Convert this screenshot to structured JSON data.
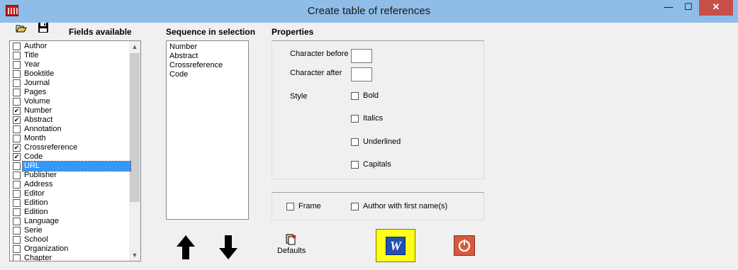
{
  "window": {
    "title": "Create table of references",
    "minimize": "—",
    "maximize": "☐",
    "close": "✕"
  },
  "toolbar": {
    "open_icon": "folder-open-icon",
    "save_icon": "floppy-save-icon"
  },
  "fields": {
    "heading": "Fields available",
    "items": [
      {
        "label": "Author",
        "checked": false
      },
      {
        "label": "Title",
        "checked": false
      },
      {
        "label": "Year",
        "checked": false
      },
      {
        "label": "Booktitle",
        "checked": false
      },
      {
        "label": "Journal",
        "checked": false
      },
      {
        "label": "Pages",
        "checked": false
      },
      {
        "label": "Volume",
        "checked": false
      },
      {
        "label": "Number",
        "checked": true
      },
      {
        "label": "Abstract",
        "checked": true
      },
      {
        "label": "Annotation",
        "checked": false
      },
      {
        "label": "Month",
        "checked": false
      },
      {
        "label": "Crossreference",
        "checked": true
      },
      {
        "label": "Code",
        "checked": true
      },
      {
        "label": "URL",
        "checked": false,
        "selected": true
      },
      {
        "label": "Publisher",
        "checked": false
      },
      {
        "label": "Address",
        "checked": false
      },
      {
        "label": "Editor",
        "checked": false
      },
      {
        "label": "Edition",
        "checked": false
      },
      {
        "label": "Edition",
        "checked": false
      },
      {
        "label": "Language",
        "checked": false
      },
      {
        "label": "Serie",
        "checked": false
      },
      {
        "label": "School",
        "checked": false
      },
      {
        "label": "Organization",
        "checked": false
      },
      {
        "label": "Chapter",
        "checked": false
      }
    ]
  },
  "sequence": {
    "heading": "Sequence in selection",
    "items": [
      "Number",
      "Abstract",
      "Crossreference",
      "Code"
    ]
  },
  "properties": {
    "heading": "Properties",
    "char_before_label": "Character before",
    "char_before_value": "",
    "char_after_label": "Character after",
    "char_after_value": "",
    "style_label": "Style",
    "bold_label": "Bold",
    "italics_label": "Italics",
    "underlined_label": "Underlined",
    "capitals_label": "Capitals",
    "frame_label": "Frame",
    "author_first_name_label": "Author with first name(s)"
  },
  "actions": {
    "up_icon": "arrow-up-icon",
    "down_icon": "arrow-down-icon",
    "defaults_label": "Defaults",
    "word_glyph": "W",
    "word_icon": "word-icon",
    "power_icon": "power-icon"
  },
  "colors": {
    "titlebar": "#8fbde8",
    "close_button": "#c7504b",
    "selection": "#3399ff",
    "word_button": "#ffff1a",
    "power_button": "#d65a3d"
  }
}
